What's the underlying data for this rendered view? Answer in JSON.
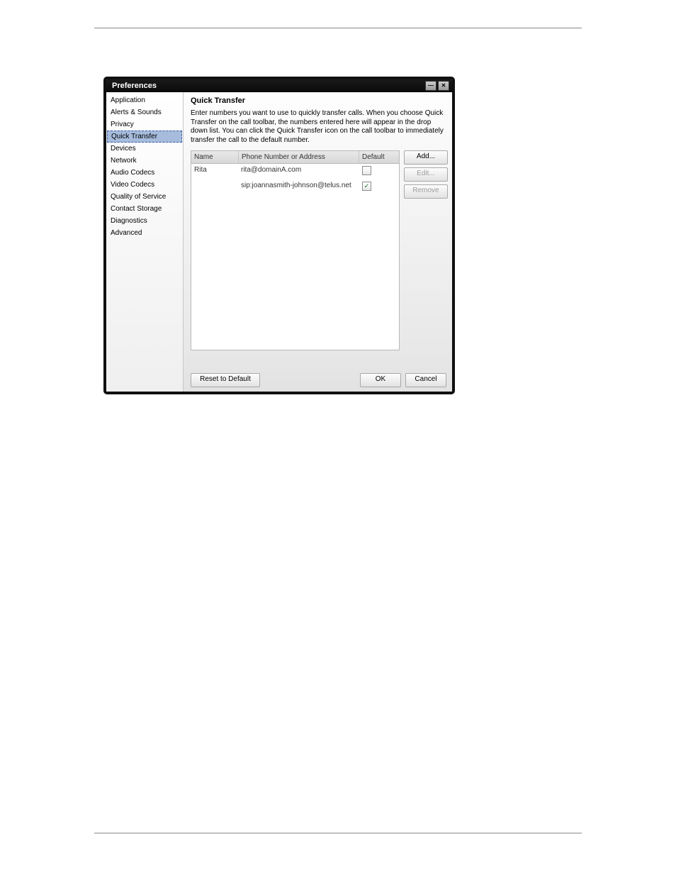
{
  "titlebar": {
    "title": "Preferences",
    "minimize_label": "Minimize",
    "close_label": "Close"
  },
  "sidebar": {
    "items": [
      {
        "label": "Application",
        "selected": false
      },
      {
        "label": "Alerts & Sounds",
        "selected": false
      },
      {
        "label": "Privacy",
        "selected": false
      },
      {
        "label": "Quick Transfer",
        "selected": true
      },
      {
        "label": "Devices",
        "selected": false
      },
      {
        "label": "Network",
        "selected": false
      },
      {
        "label": "Audio Codecs",
        "selected": false
      },
      {
        "label": "Video Codecs",
        "selected": false
      },
      {
        "label": "Quality of Service",
        "selected": false
      },
      {
        "label": "Contact Storage",
        "selected": false
      },
      {
        "label": "Diagnostics",
        "selected": false
      },
      {
        "label": "Advanced",
        "selected": false
      }
    ]
  },
  "content": {
    "section_title": "Quick Transfer",
    "description": "Enter numbers you want to use to quickly transfer calls. When you choose Quick Transfer on the call toolbar, the numbers entered here will appear in the drop down list. You can click the Quick Transfer icon on the call toolbar to immediately transfer the call to the default number.",
    "table": {
      "headers": {
        "name": "Name",
        "address": "Phone Number or Address",
        "default": "Default"
      },
      "rows": [
        {
          "name": "Rita",
          "address": "rita@domainA.com",
          "default": false
        },
        {
          "name": "",
          "address": "sip:joannasmith-johnson@telus.net",
          "default": true
        }
      ]
    },
    "buttons": {
      "add": "Add...",
      "edit": "Edit...",
      "remove": "Remove",
      "reset": "Reset to Default",
      "ok": "OK",
      "cancel": "Cancel"
    }
  }
}
